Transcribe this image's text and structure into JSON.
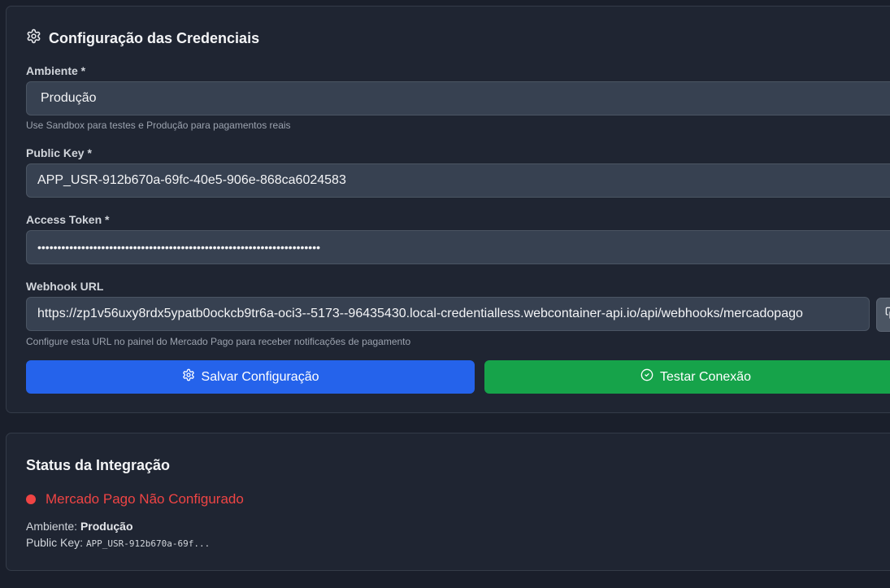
{
  "config": {
    "title": "Configuração das Credenciais",
    "icon": "gear-icon",
    "environment": {
      "label": "Ambiente *",
      "value": "Produção",
      "hint": "Use Sandbox para testes e Produção para pagamentos reais"
    },
    "public_key": {
      "label": "Public Key *",
      "value": "APP_USR-912b670a-69fc-40e5-906e-868ca6024583"
    },
    "access_token": {
      "label": "Access Token *",
      "value": "•••••••••••••••••••••••••••••••••••••••••••••••••••••••••••••••••••••••"
    },
    "webhook": {
      "label": "Webhook URL",
      "value": "https://zp1v56uxy8rdx5ypatb0ockcb9tr6a-oci3--5173--96435430.local-credentialless.webcontainer-api.io/api/webhooks/mercadopago",
      "hint": "Configure esta URL no painel do Mercado Pago para receber notificações de pagamento"
    },
    "save_button": "Salvar Configuração",
    "test_button": "Testar Conexão"
  },
  "status": {
    "title": "Status da Integração",
    "state": "Mercado Pago Não Configurado",
    "environment_label": "Ambiente:",
    "environment_value": "Produção",
    "public_key_label": "Public Key:",
    "public_key_value": "APP_USR-912b670a-69f..."
  },
  "colors": {
    "background": "#1a1f2b",
    "card": "#1f2532",
    "input": "#374151",
    "primary": "#2563eb",
    "success": "#16a34a",
    "error": "#ef4444"
  }
}
